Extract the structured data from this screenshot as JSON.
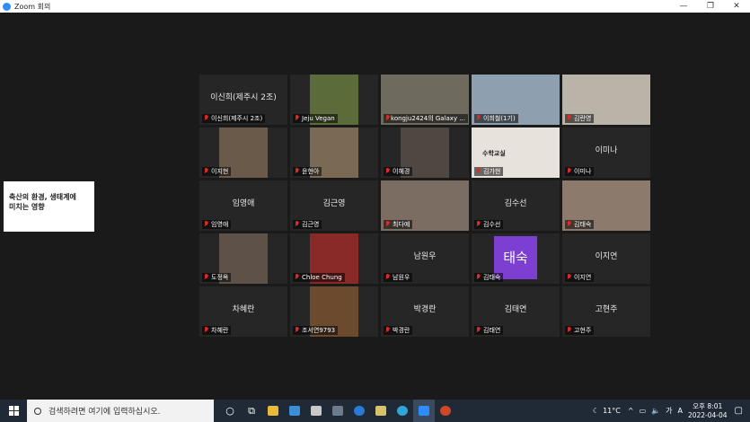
{
  "window": {
    "title": "Zoom 회의",
    "minimize": "—",
    "maximize": "❐",
    "close": "✕"
  },
  "shared_slide": {
    "line1": "축산의 환경, 생태계에",
    "line2": "미치는 영향"
  },
  "tiles": [
    {
      "big": "이신희(제주시 2조)",
      "label": "이신희(제주시 2조)",
      "photo": null
    },
    {
      "big": "",
      "label": "Jeju Vegan",
      "photo": "#5b6b3a",
      "photo_note": ""
    },
    {
      "big": "",
      "label": "kongju2424의 Galaxy ...",
      "photo": "#6f6a5e"
    },
    {
      "big": "",
      "label": "이희철(1기)",
      "photo": "#8ea0b0",
      "active": true
    },
    {
      "big": "",
      "label": "김란영",
      "photo": "#b9b3a8"
    },
    {
      "big": "",
      "label": "이지현",
      "photo": "#6a5a4a"
    },
    {
      "big": "",
      "label": "윤현아",
      "photo": "#7a6a55"
    },
    {
      "big": "",
      "label": "이혜경",
      "photo": "#4f4842"
    },
    {
      "big": "",
      "label": "김가현",
      "photo": "#e8e2dc",
      "photo_text": "수학교실"
    },
    {
      "big": "이미나",
      "label": "이미나",
      "photo": null
    },
    {
      "big": "임영애",
      "label": "임영애",
      "photo": null
    },
    {
      "big": "김근영",
      "label": "김근영",
      "photo": null
    },
    {
      "big": "",
      "label": "최다예",
      "photo": "#7b6d62"
    },
    {
      "big": "김수선",
      "label": "김수선",
      "photo": null
    },
    {
      "big": "",
      "label": "김태숙",
      "photo": "#8c7a6c"
    },
    {
      "big": "",
      "label": "도정옥",
      "photo": "#5e5248"
    },
    {
      "big": "",
      "label": "Chloe Chung",
      "photo": "#8a2a28"
    },
    {
      "big": "남원우",
      "label": "남원우",
      "photo": null
    },
    {
      "big": "",
      "label": "김태숙",
      "photo": null,
      "avatar": "태숙"
    },
    {
      "big": "이지연",
      "label": "이지연",
      "photo": null
    },
    {
      "big": "차혜란",
      "label": "차혜란",
      "photo": null
    },
    {
      "big": "",
      "label": "조서연9793",
      "photo": "#6b4a2e"
    },
    {
      "big": "박경란",
      "label": "박경란",
      "photo": null
    },
    {
      "big": "김태연",
      "label": "김태연",
      "photo": null
    },
    {
      "big": "고현주",
      "label": "고현주",
      "photo": null
    }
  ],
  "taskbar": {
    "search_placeholder": "검색하려면 여기에 입력하십시오.",
    "weather": "11°C",
    "ime": "A",
    "time": "오후 8:01",
    "date": "2022-04-04"
  }
}
